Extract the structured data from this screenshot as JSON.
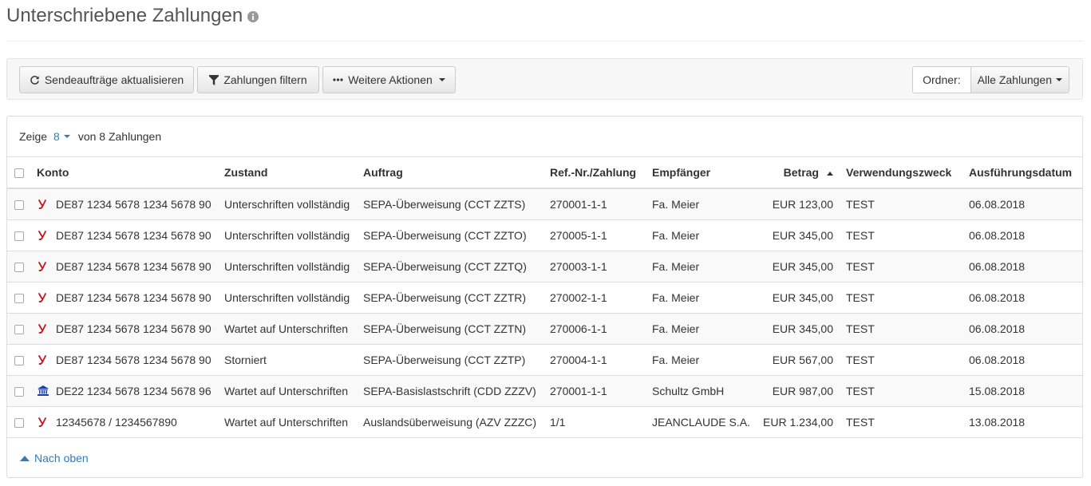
{
  "page": {
    "title": "Unterschriebene Zahlungen"
  },
  "toolbar": {
    "refresh_label": "Sendeaufträge aktualisieren",
    "filter_label": "Zahlungen filtern",
    "more_label": "Weitere Aktionen",
    "folder_label": "Ordner:",
    "folder_value": "Alle Zahlungen"
  },
  "summary": {
    "prefix": "Zeige",
    "count": "8",
    "suffix": "von 8 Zahlungen"
  },
  "columns": {
    "konto": "Konto",
    "zustand": "Zustand",
    "auftrag": "Auftrag",
    "ref": "Ref.-Nr./Zahlung",
    "empfaenger": "Empfänger",
    "betrag": "Betrag",
    "zweck": "Verwendungszweck",
    "datum": "Ausführungsdatum"
  },
  "rows": [
    {
      "icon": "y-bank-icon",
      "konto": "DE87 1234 5678 1234 5678 90",
      "zustand": "Unterschriften vollständig",
      "auftrag": "SEPA-Überweisung (CCT ZZTS)",
      "ref": "270001-1-1",
      "empfaenger": "Fa. Meier",
      "betrag": "EUR 123,00",
      "zweck": "TEST",
      "datum": "06.08.2018"
    },
    {
      "icon": "y-bank-icon",
      "konto": "DE87 1234 5678 1234 5678 90",
      "zustand": "Unterschriften vollständig",
      "auftrag": "SEPA-Überweisung (CCT ZZTO)",
      "ref": "270005-1-1",
      "empfaenger": "Fa. Meier",
      "betrag": "EUR 345,00",
      "zweck": "TEST",
      "datum": "06.08.2018"
    },
    {
      "icon": "y-bank-icon",
      "konto": "DE87 1234 5678 1234 5678 90",
      "zustand": "Unterschriften vollständig",
      "auftrag": "SEPA-Überweisung (CCT ZZTQ)",
      "ref": "270003-1-1",
      "empfaenger": "Fa. Meier",
      "betrag": "EUR 345,00",
      "zweck": "TEST",
      "datum": "06.08.2018"
    },
    {
      "icon": "y-bank-icon",
      "konto": "DE87 1234 5678 1234 5678 90",
      "zustand": "Unterschriften vollständig",
      "auftrag": "SEPA-Überweisung (CCT ZZTR)",
      "ref": "270002-1-1",
      "empfaenger": "Fa. Meier",
      "betrag": "EUR 345,00",
      "zweck": "TEST",
      "datum": "06.08.2018"
    },
    {
      "icon": "y-bank-icon",
      "konto": "DE87 1234 5678 1234 5678 90",
      "zustand": "Wartet auf Unterschriften",
      "auftrag": "SEPA-Überweisung (CCT ZZTN)",
      "ref": "270006-1-1",
      "empfaenger": "Fa. Meier",
      "betrag": "EUR 345,00",
      "zweck": "TEST",
      "datum": "06.08.2018"
    },
    {
      "icon": "y-bank-icon",
      "konto": "DE87 1234 5678 1234 5678 90",
      "zustand": "Storniert",
      "auftrag": "SEPA-Überweisung (CCT ZZTP)",
      "ref": "270004-1-1",
      "empfaenger": "Fa. Meier",
      "betrag": "EUR 567,00",
      "zweck": "TEST",
      "datum": "06.08.2018"
    },
    {
      "icon": "bank-building-icon",
      "konto": "DE22 1234 5678 1234 5678 96",
      "zustand": "Wartet auf Unterschriften",
      "auftrag": "SEPA-Basislastschrift (CDD ZZZV)",
      "ref": "270001-1-1",
      "empfaenger": "Schultz GmbH",
      "betrag": "EUR 987,00",
      "zweck": "TEST",
      "datum": "15.08.2018"
    },
    {
      "icon": "y-bank-icon",
      "konto": "12345678 / 1234567890",
      "zustand": "Wartet auf Unterschriften",
      "auftrag": "Auslandsüberweisung (AZV ZZZC)",
      "ref": "1/1",
      "empfaenger": "JEANCLAUDE S.A.",
      "betrag": "EUR 1.234,00",
      "zweck": "TEST",
      "datum": "13.08.2018"
    }
  ],
  "footer": {
    "back_to_top": "Nach oben"
  },
  "colors": {
    "link": "#337ab7",
    "y_icon": "#c0161c",
    "bank_icon": "#1f3fa8"
  }
}
